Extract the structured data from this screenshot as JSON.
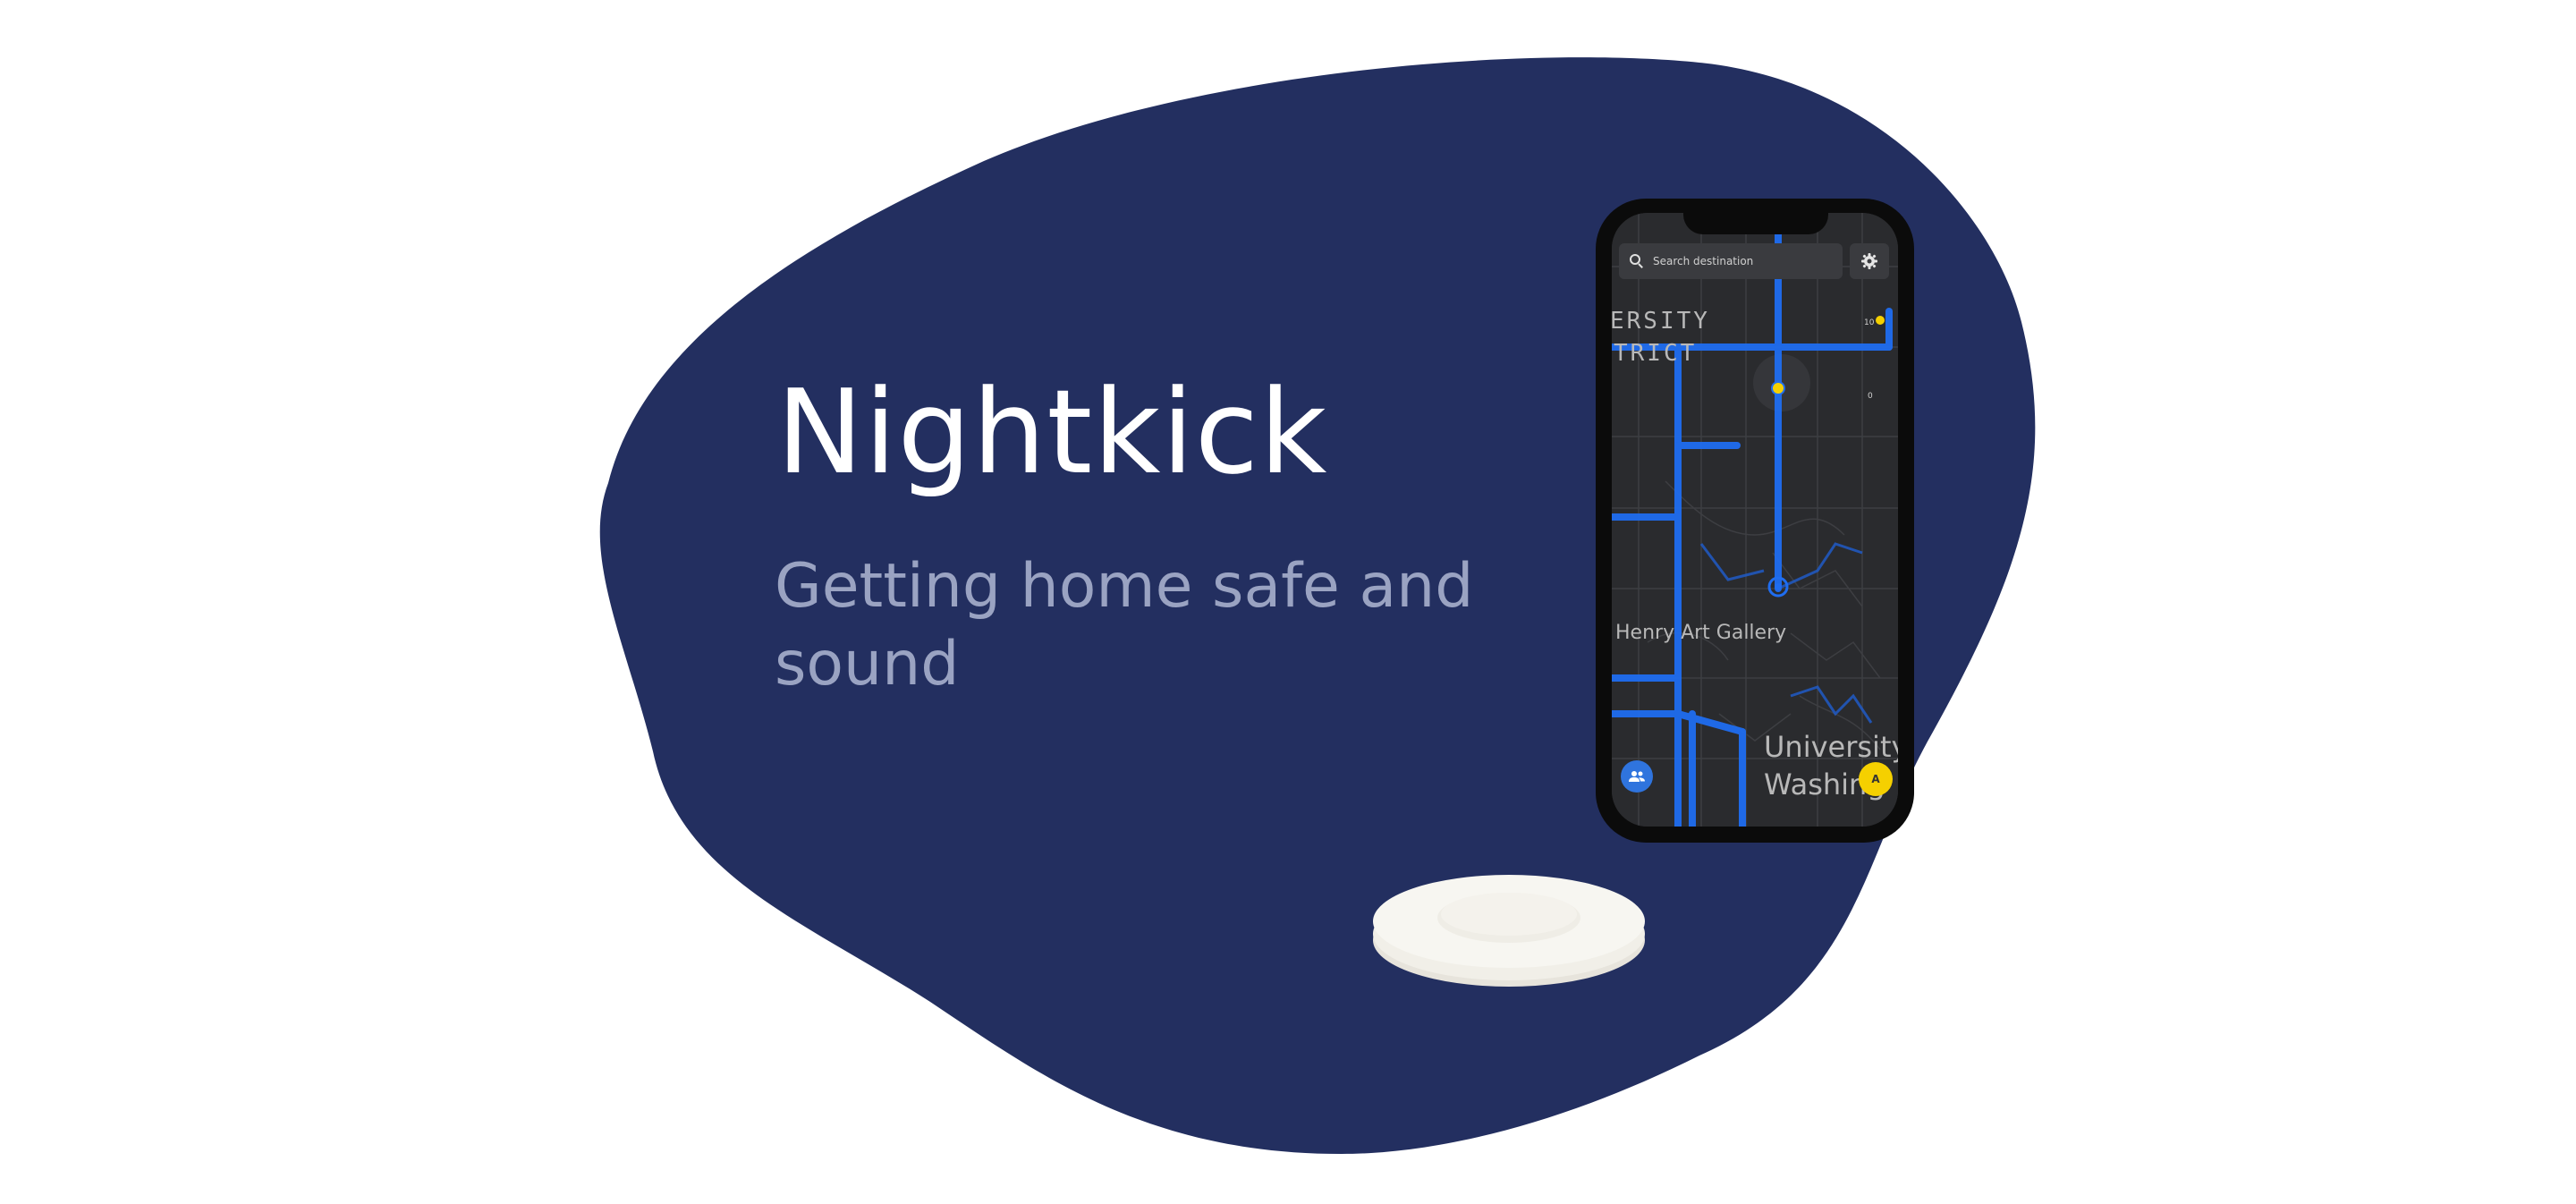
{
  "hero": {
    "title": "Nightkick",
    "tagline": "Getting home safe and sound"
  },
  "colors": {
    "background": "#ffffff",
    "blob": "#232f60",
    "title_text": "#ffffff",
    "tagline_text": "#9aa3c2",
    "route_blue": "#1f6df0",
    "map_dark": "#2a2b2e",
    "alert_yellow": "#f5d000",
    "friends_blue": "#2f74de"
  },
  "app": {
    "search": {
      "placeholder": "Search destination"
    },
    "map_labels": {
      "district_line1": "ERSITY",
      "district_line2": "TRICT",
      "gallery": "Henry Art Gallery",
      "university_line1": "University",
      "university_line2": "Washing"
    },
    "zoom": {
      "top": "10",
      "bottom": "0"
    },
    "icons": {
      "search": "search-icon",
      "settings": "gear-icon",
      "friends": "people-icon",
      "alert": "alert-icon"
    },
    "alert_label": "A"
  },
  "device": {
    "puck": "white round safety button device"
  }
}
